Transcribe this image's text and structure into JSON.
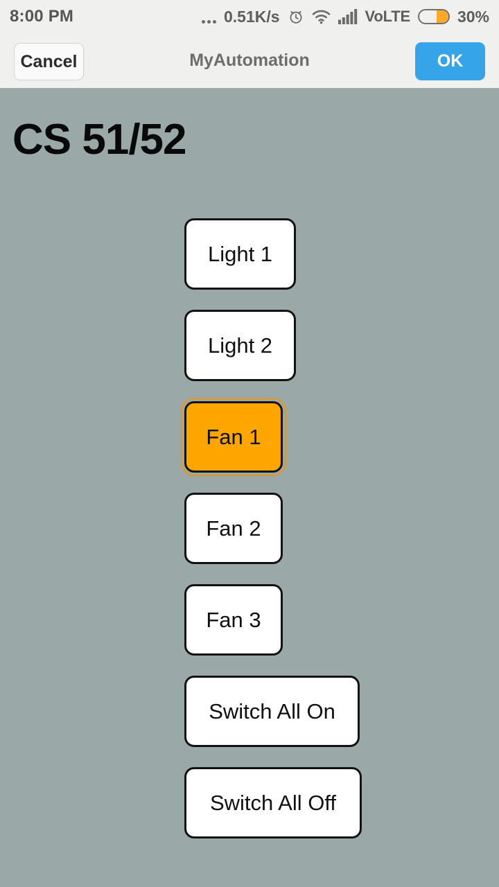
{
  "status_bar": {
    "time": "8:00 PM",
    "dots_icon": "overflow-dots-icon",
    "network_speed": "0.51K/s",
    "alarm_icon": "alarm-clock-icon",
    "wifi_icon": "wifi-icon",
    "signal_icon": "cellular-signal-icon",
    "volte": "VoLTE",
    "battery_icon": "battery-icon",
    "battery_percent": "30%",
    "battery_level": 30,
    "background": "#f0f0ef",
    "text_color": "#5d5d5d",
    "battery_fill_color": "#ffa726"
  },
  "nav_bar": {
    "cancel_label": "Cancel",
    "title": "MyAutomation",
    "ok_label": "OK",
    "ok_color": "#35a4e8",
    "background": "#f0f0ef"
  },
  "content": {
    "heading": "CS 51/52",
    "background": "#9aa9a8",
    "active_color": "#ffa500",
    "focus_outline_color": "#e8961b",
    "buttons": [
      {
        "label": "Light 1",
        "state": "off",
        "focused": false,
        "width_class": "w-light"
      },
      {
        "label": "Light 2",
        "state": "off",
        "focused": false,
        "width_class": "w-light"
      },
      {
        "label": "Fan 1",
        "state": "on",
        "focused": true,
        "width_class": "w-fan"
      },
      {
        "label": "Fan 2",
        "state": "off",
        "focused": false,
        "width_class": "w-fan"
      },
      {
        "label": "Fan 3",
        "state": "off",
        "focused": false,
        "width_class": "w-fan"
      },
      {
        "label": "Switch All On",
        "state": "off",
        "focused": false,
        "width_class": "w-allon"
      },
      {
        "label": "Switch All Off",
        "state": "off",
        "focused": false,
        "width_class": "w-alloff"
      }
    ]
  }
}
